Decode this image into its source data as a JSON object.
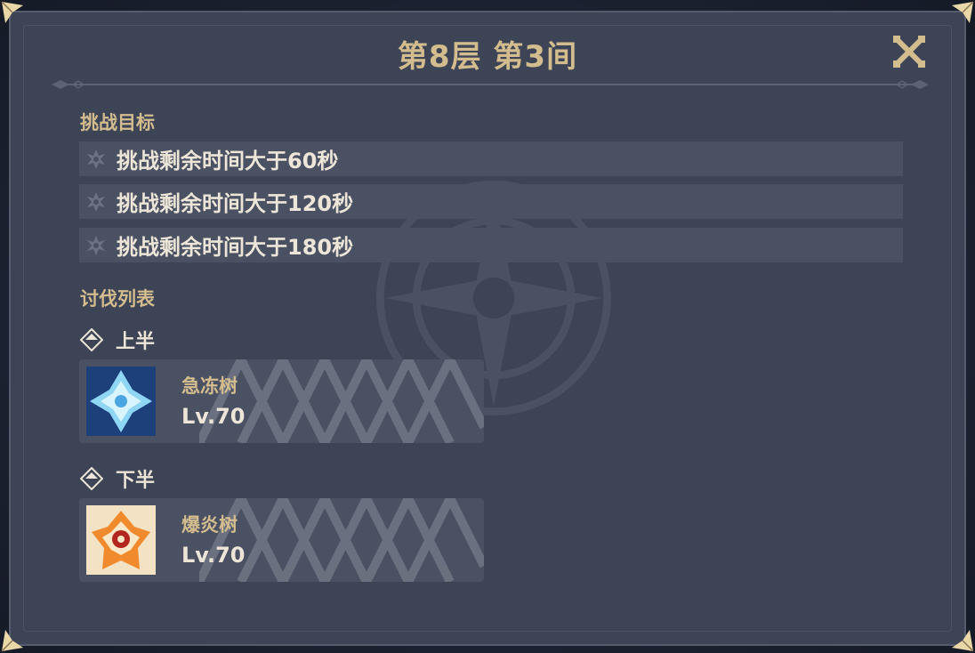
{
  "header": {
    "title": "第8层 第3间"
  },
  "goals": {
    "label": "挑战目标",
    "items": [
      {
        "text": "挑战剩余时间大于60秒"
      },
      {
        "text": "挑战剩余时间大于120秒"
      },
      {
        "text": "挑战剩余时间大于180秒"
      }
    ]
  },
  "enemies": {
    "label": "讨伐列表",
    "first_half": {
      "label": "上半",
      "enemy": {
        "name": "急冻树",
        "level": "Lv.70",
        "icon": "cryo-regisvine-icon"
      }
    },
    "second_half": {
      "label": "下半",
      "enemy": {
        "name": "爆炎树",
        "level": "Lv.70",
        "icon": "pyro-regisvine-icon"
      }
    }
  },
  "colors": {
    "panel_bg": "#3d4455",
    "row_bg": "#4a5163",
    "gold_text": "#d3bc8e",
    "light_text": "#ece5d8"
  }
}
